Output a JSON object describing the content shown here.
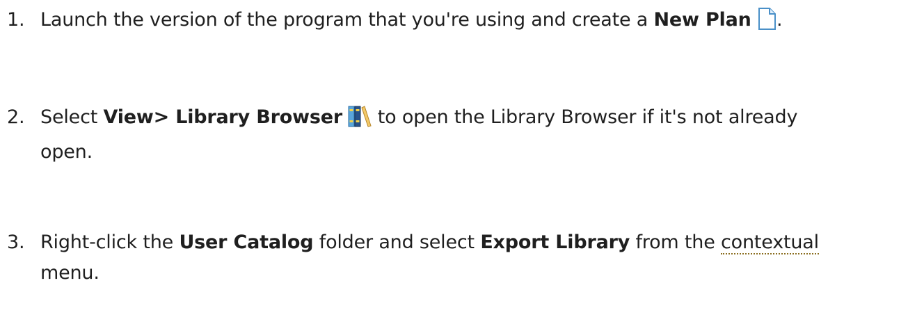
{
  "steps": [
    {
      "number": "1.",
      "text_a": "Launch the version of the program that you're using and create a ",
      "bold_a": "New Plan",
      "text_b": "."
    },
    {
      "number": "2.",
      "text_a": "Select ",
      "bold_a": "View> Library Browser",
      "text_b": " to open the Library Browser if it's not already",
      "text_c": "open."
    },
    {
      "number": "3.",
      "text_a": "Right-click the ",
      "bold_a": "User Catalog",
      "text_b": " folder and select ",
      "bold_b": "Export Library",
      "text_c": " from the ",
      "link_a": "contextual",
      "text_d": "menu."
    }
  ],
  "icons": {
    "new_plan": "new-plan-document-icon",
    "library_browser": "library-browser-books-icon"
  },
  "colors": {
    "text": "#1f1f1f",
    "link_underline": "#8a6d1e"
  }
}
